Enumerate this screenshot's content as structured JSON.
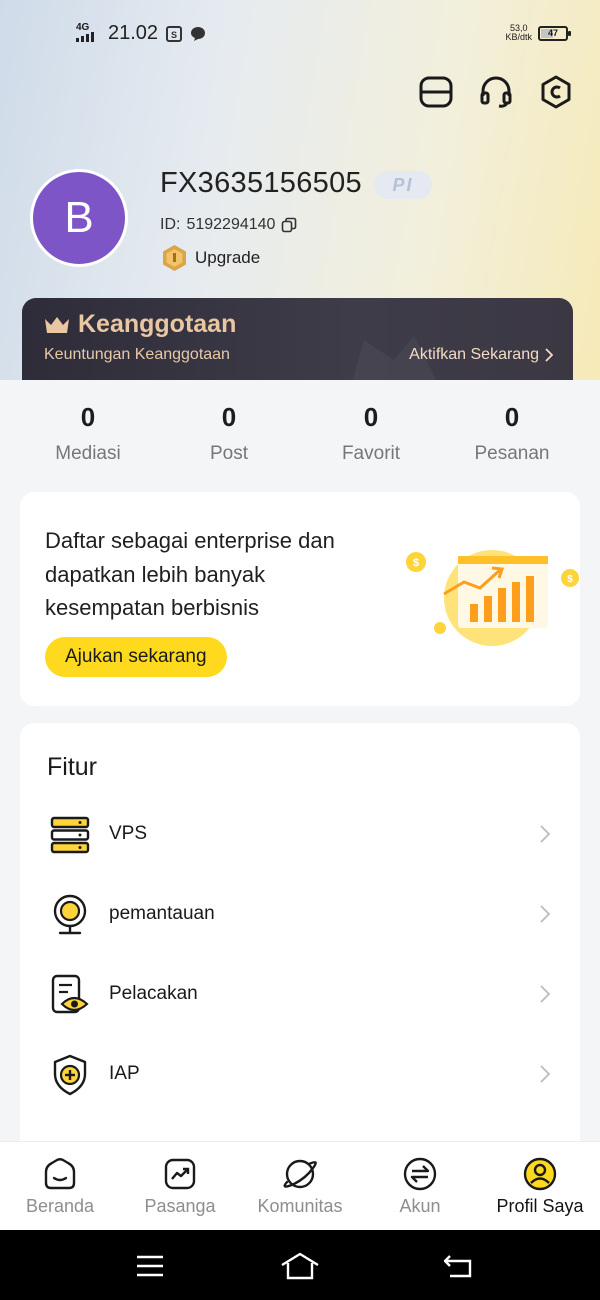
{
  "status_bar": {
    "network": "4G",
    "time": "21.02",
    "speed_value": "53,0",
    "speed_unit": "KB/dtk",
    "battery": "47"
  },
  "header_icons": [
    "scan-icon",
    "headset-icon",
    "settings-icon"
  ],
  "profile": {
    "avatar_letter": "B",
    "username": "FX3635156505",
    "badge": "PI",
    "id_label": "ID:",
    "id_value": "5192294140",
    "upgrade_label": "Upgrade"
  },
  "membership": {
    "title": "Keanggotaan",
    "subtitle": "Keuntungan Keanggotaan",
    "action": "Aktifkan Sekarang"
  },
  "stats": [
    {
      "value": "0",
      "label": "Mediasi"
    },
    {
      "value": "0",
      "label": "Post"
    },
    {
      "value": "0",
      "label": "Favorit"
    },
    {
      "value": "0",
      "label": "Pesanan"
    }
  ],
  "enterprise": {
    "line1": "Daftar sebagai enterprise dan",
    "line2": "dapatkan lebih banyak",
    "line3": "kesempatan berbisnis",
    "button": "Ajukan sekarang"
  },
  "features": {
    "title": "Fitur",
    "items": [
      {
        "label": "VPS",
        "icon": "server-icon"
      },
      {
        "label": "pemantauan",
        "icon": "webcam-icon"
      },
      {
        "label": "Pelacakan",
        "icon": "document-eye-icon"
      },
      {
        "label": "IAP",
        "icon": "shield-plus-icon"
      }
    ]
  },
  "bottom_nav": [
    {
      "label": "Beranda",
      "icon": "home-icon"
    },
    {
      "label": "Pasanga",
      "icon": "chart-icon"
    },
    {
      "label": "Komunitas",
      "icon": "planet-icon"
    },
    {
      "label": "Akun",
      "icon": "transfer-icon"
    },
    {
      "label": "Profil Saya",
      "icon": "profile-icon",
      "active": true
    }
  ],
  "colors": {
    "accent": "#ffd91e",
    "avatar": "#7d55c7",
    "membership_bg": "#35323f",
    "membership_text": "#e9c7a2"
  }
}
